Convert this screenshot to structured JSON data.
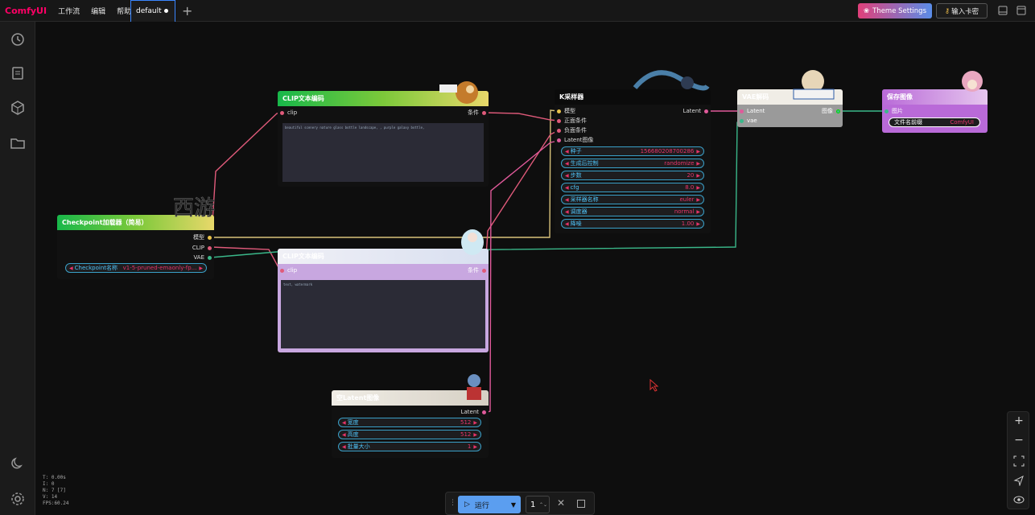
{
  "app": {
    "logo": "ComfyUI"
  },
  "menu": {
    "items": [
      "工作流",
      "编辑",
      "帮助"
    ]
  },
  "tabs": [
    {
      "label": "default",
      "modified": true
    }
  ],
  "topbar": {
    "theme_label": "Theme Settings",
    "key_label": "输入卡密"
  },
  "sidebar": {
    "icons": [
      "history-icon",
      "queue-icon",
      "cube-icon",
      "folder-icon",
      "moon-icon",
      "gear-icon"
    ]
  },
  "nodes": {
    "clip_top": {
      "title": "CLIP文本编码",
      "input": "clip",
      "output": "条件",
      "text": "beautiful scenery nature glass bottle landscape, , purple galaxy bottle,"
    },
    "clip_bottom": {
      "title": "CLIP文本编码",
      "input": "clip",
      "output": "条件",
      "text": "text, watermark"
    },
    "checkpoint": {
      "title": "Checkpoint加载器（简易）",
      "outputs": [
        "模型",
        "CLIP",
        "VAE"
      ],
      "widget_label": "Checkpoint名称",
      "widget_value": "v1-5-pruned-emaonly-fp..."
    },
    "ksampler": {
      "title": "K采样器",
      "inputs": [
        "模型",
        "正面条件",
        "负面条件",
        "Latent图像"
      ],
      "output": "Latent",
      "widgets": [
        {
          "label": "种子",
          "value": "156680208700286"
        },
        {
          "label": "生成后控制",
          "value": "randomize"
        },
        {
          "label": "步数",
          "value": "20"
        },
        {
          "label": "cfg",
          "value": "8.0"
        },
        {
          "label": "采样器名称",
          "value": "euler"
        },
        {
          "label": "调度器",
          "value": "normal"
        },
        {
          "label": "降噪",
          "value": "1.00"
        }
      ]
    },
    "vae": {
      "title": "VAE解码",
      "inputs": [
        "Latent",
        "vae"
      ],
      "output": "图像"
    },
    "save": {
      "title": "保存图像",
      "input": "图片",
      "widget_label": "文件名前缀",
      "widget_value": "ComfyUI"
    },
    "latent": {
      "title": "空Latent图像",
      "output": "Latent",
      "widgets": [
        {
          "label": "宽度",
          "value": "512"
        },
        {
          "label": "高度",
          "value": "512"
        },
        {
          "label": "批量大小",
          "value": "1"
        }
      ]
    }
  },
  "stats": [
    "T: 0.00s",
    "I: 0",
    "N: 7 [7]",
    "V: 14",
    "FPS:60.24"
  ],
  "runbar": {
    "run_label": "运行",
    "count": "1"
  },
  "colors": {
    "accent": "#3a86ff",
    "widget_value": "#e8346a",
    "widget_label": "#4fc3f7",
    "link_model": "#d8c27a",
    "link_clip": "#e05a7a",
    "link_vae": "#3ab88a",
    "link_latent": "#e05a9a"
  }
}
